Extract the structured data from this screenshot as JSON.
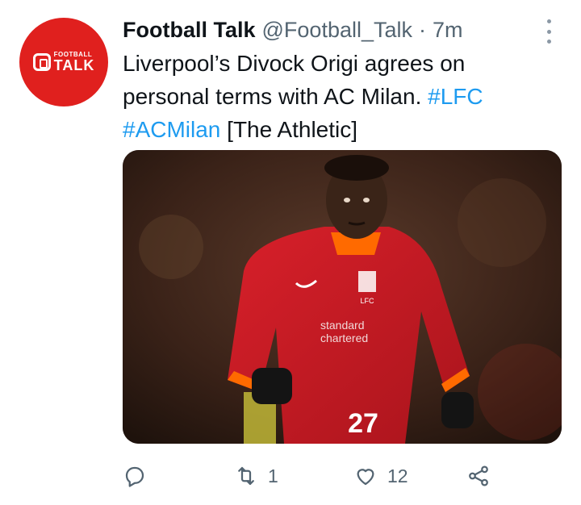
{
  "tweet": {
    "display_name": "Football Talk",
    "handle": "@Football_Talk",
    "separator": "·",
    "time": "7m",
    "text_plain": "Liverpool’s Divock Origi agrees on personal terms with AC Milan.",
    "hashtag_1": "#LFC",
    "hashtag_2": "#ACMilan",
    "text_tail": "[The Athletic]",
    "avatar": {
      "logo_small": "FOOTBALL",
      "logo_big": "TALK",
      "bg_color": "#e0201e"
    },
    "media": {
      "sponsor_line1": "standard",
      "sponsor_line2": "chartered",
      "shirt_number": "27",
      "crest_text": "LFC"
    }
  },
  "actions": {
    "reply_icon": "reply-icon",
    "retweet_icon": "retweet-icon",
    "retweet_count": "1",
    "like_icon": "heart-icon",
    "like_count": "12",
    "share_icon": "share-icon"
  },
  "colors": {
    "link": "#1d9bf0",
    "muted": "#536471",
    "text": "#0f1419"
  }
}
